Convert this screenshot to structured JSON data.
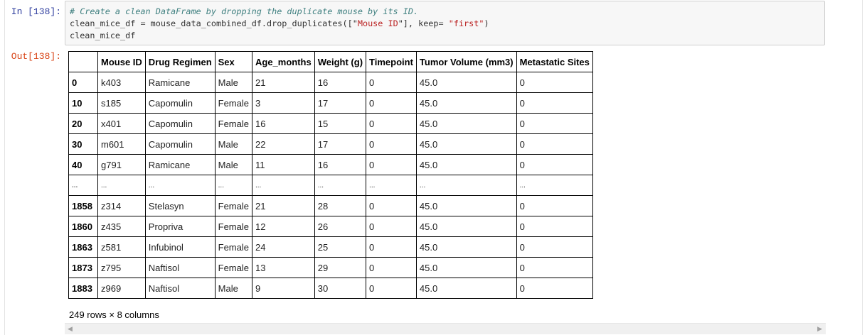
{
  "cell": {
    "in_prompt": "In [138]:",
    "out_prompt": "Out[138]:",
    "code_lines": [
      [
        {
          "t": "c-comment",
          "v": "# Create a clean DataFrame by dropping the duplicate mouse by its ID."
        }
      ],
      [
        {
          "t": "",
          "v": "clean_mice_df "
        },
        {
          "t": "c-op",
          "v": "="
        },
        {
          "t": "",
          "v": " mouse_data_combined_df.drop_duplicates([\""
        },
        {
          "t": "c-str",
          "v": "Mouse ID"
        },
        {
          "t": "",
          "v": "\"], keep"
        },
        {
          "t": "c-op",
          "v": "="
        },
        {
          "t": "",
          "v": " "
        },
        {
          "t": "c-str",
          "v": "\"first\""
        },
        {
          "t": "",
          "v": ")"
        }
      ],
      [
        {
          "t": "",
          "v": "clean_mice_df"
        }
      ]
    ]
  },
  "dataframe": {
    "columns": [
      "",
      "Mouse ID",
      "Drug Regimen",
      "Sex",
      "Age_months",
      "Weight (g)",
      "Timepoint",
      "Tumor Volume (mm3)",
      "Metastatic Sites"
    ],
    "rows": [
      [
        "0",
        "k403",
        "Ramicane",
        "Male",
        "21",
        "16",
        "0",
        "45.0",
        "0"
      ],
      [
        "10",
        "s185",
        "Capomulin",
        "Female",
        "3",
        "17",
        "0",
        "45.0",
        "0"
      ],
      [
        "20",
        "x401",
        "Capomulin",
        "Female",
        "16",
        "15",
        "0",
        "45.0",
        "0"
      ],
      [
        "30",
        "m601",
        "Capomulin",
        "Male",
        "22",
        "17",
        "0",
        "45.0",
        "0"
      ],
      [
        "40",
        "g791",
        "Ramicane",
        "Male",
        "11",
        "16",
        "0",
        "45.0",
        "0"
      ],
      [
        "...",
        "...",
        "...",
        "...",
        "...",
        "...",
        "...",
        "...",
        "..."
      ],
      [
        "1858",
        "z314",
        "Stelasyn",
        "Female",
        "21",
        "28",
        "0",
        "45.0",
        "0"
      ],
      [
        "1860",
        "z435",
        "Propriva",
        "Female",
        "12",
        "26",
        "0",
        "45.0",
        "0"
      ],
      [
        "1863",
        "z581",
        "Infubinol",
        "Female",
        "24",
        "25",
        "0",
        "45.0",
        "0"
      ],
      [
        "1873",
        "z795",
        "Naftisol",
        "Female",
        "13",
        "29",
        "0",
        "45.0",
        "0"
      ],
      [
        "1883",
        "z969",
        "Naftisol",
        "Male",
        "9",
        "30",
        "0",
        "45.0",
        "0"
      ]
    ],
    "shape_caption": "249 rows × 8 columns"
  },
  "scrollbar": {
    "left_arrow": "◀",
    "right_arrow": "▶"
  }
}
